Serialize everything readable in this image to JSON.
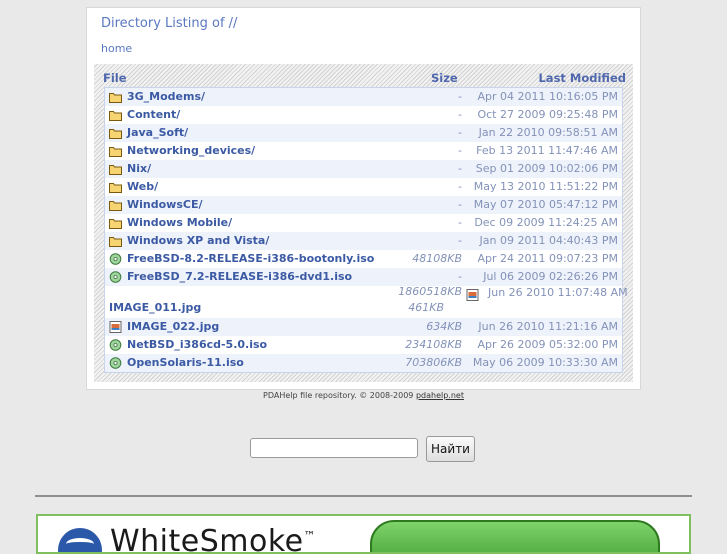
{
  "listing": {
    "title": "Directory Listing of //",
    "home_link": "home",
    "columns": {
      "file": "File",
      "size": "Size",
      "modified": "Last Modified"
    },
    "rows": [
      {
        "name": "3G_Modems/",
        "size": "-",
        "date": "Apr 04 2011 10:16:05 PM",
        "icon": "folder-icon"
      },
      {
        "name": "Content/",
        "size": "-",
        "date": "Oct 27 2009 09:25:48 PM",
        "icon": "folder-icon"
      },
      {
        "name": "Java_Soft/",
        "size": "-",
        "date": "Jan 22 2010 09:58:51 AM",
        "icon": "folder-icon"
      },
      {
        "name": "Networking_devices/",
        "size": "-",
        "date": "Feb 13 2011 11:47:46 AM",
        "icon": "folder-icon"
      },
      {
        "name": "Nix/",
        "size": "-",
        "date": "Sep 01 2009 10:02:06 PM",
        "icon": "folder-icon"
      },
      {
        "name": "Web/",
        "size": "-",
        "date": "May 13 2010 11:51:22 PM",
        "icon": "folder-icon"
      },
      {
        "name": "WindowsCE/",
        "size": "-",
        "date": "May 07 2010 05:47:12 PM",
        "icon": "folder-icon"
      },
      {
        "name": "Windows Mobile/",
        "size": "-",
        "date": "Dec 09 2009 11:24:25 AM",
        "icon": "folder-icon"
      },
      {
        "name": "Windows XP and Vista/",
        "size": "-",
        "date": "Jan 09 2011 04:40:43 PM",
        "icon": "folder-icon"
      },
      {
        "name": "FreeBSD-8.2-RELEASE-i386-bootonly.iso",
        "size": "48108KB",
        "date": "Apr 24 2011 09:07:23 PM",
        "icon": "disc-icon"
      },
      {
        "name": "FreeBSD_7.2-RELEASE-i386-dvd1.iso",
        "size": "-",
        "date": "Jul 06 2009 02:26:26 PM",
        "icon": "disc-icon"
      }
    ],
    "special_row": {
      "size_top": "1860518KB",
      "name": "IMAGE_011.jpg",
      "size_bottom": "461KB",
      "date": "Jun 26 2010 11:07:48 AM",
      "icon": "image-icon"
    },
    "rows_after": [
      {
        "name": "IMAGE_022.jpg",
        "size": "634KB",
        "date": "Jun 26 2010 11:21:16 AM",
        "icon": "image-icon"
      },
      {
        "name": "NetBSD_i386cd-5.0.iso",
        "size": "234108KB",
        "date": "Apr 26 2009 05:32:00 PM",
        "icon": "disc-icon"
      },
      {
        "name": "OpenSolaris-11.iso",
        "size": "703806KB",
        "date": "May 06 2009 10:33:30 AM",
        "icon": "disc-icon"
      }
    ]
  },
  "footer": {
    "text": "PDAHelp file repository. © 2008-2009 ",
    "link": "pdahelp.net"
  },
  "search": {
    "button_label": "Найти",
    "placeholder": ""
  },
  "banner": {
    "brand": "WhiteSmoke",
    "trademark": "™"
  },
  "colors": {
    "link": "#3b5aa3",
    "accent": "#5a78c0",
    "folder": "#f2c14e"
  }
}
